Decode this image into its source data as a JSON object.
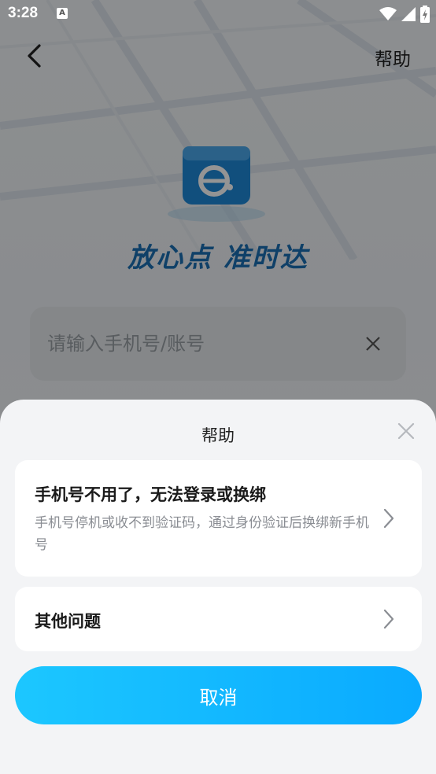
{
  "status_bar": {
    "time": "3:28",
    "notification_glyph": "A"
  },
  "header": {
    "help_label": "帮助"
  },
  "brand": {
    "slogan": "放心点 准时达"
  },
  "login": {
    "phone_placeholder": "请输入手机号/账号"
  },
  "help_sheet": {
    "title": "帮助",
    "items": [
      {
        "title": "手机号不用了，无法登录或换绑",
        "description": "手机号停机或收不到验证码，通过身份验证后换绑新手机号"
      },
      {
        "title": "其他问题",
        "description": ""
      }
    ],
    "cancel_label": "取消"
  },
  "colors": {
    "brand_blue": "#1b6fb3",
    "cancel_gradient_start": "#1cc7ff",
    "cancel_gradient_end": "#0aaaff",
    "sheet_bg": "#f3f4f6"
  }
}
